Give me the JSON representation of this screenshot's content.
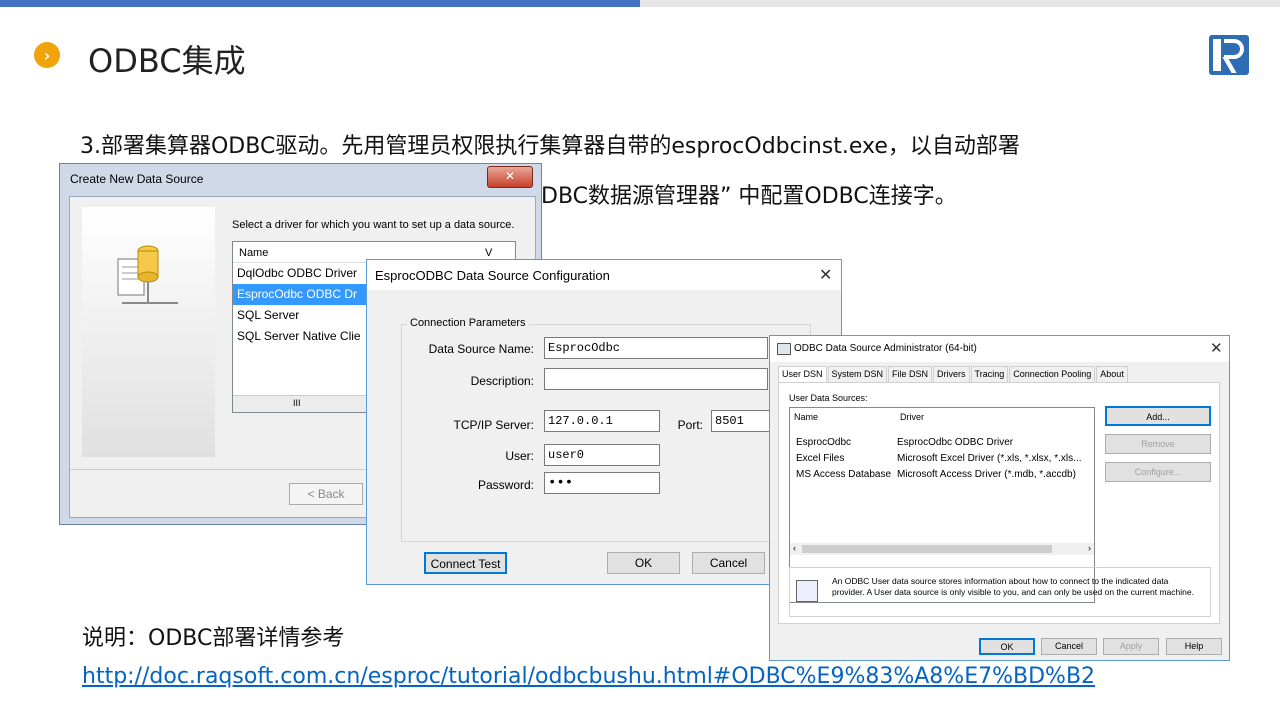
{
  "header": {
    "title": "ODBC集成",
    "bullet_glyph": "›"
  },
  "body": {
    "line1": "3.部署集算器ODBC驱动。先用管理员权限执行集算器自带的esprocOdbcinst.exe，以自动部署",
    "line2_visible": "DBC数据源管理器” 中配置ODBC连接字。"
  },
  "note": "说明：ODBC部署详情参考",
  "link": "http://doc.raqsoft.com.cn/esproc/tutorial/odbcbushu.html#ODBC%E9%83%A8%E7%BD%B2",
  "create_dialog": {
    "title": "Create New Data Source",
    "prompt": "Select a driver for which you want to set up a data source.",
    "column": "Name",
    "column2": "V",
    "drivers": [
      "DqlOdbc ODBC Driver",
      "EsprocOdbc ODBC Dr",
      "SQL Server",
      "SQL Server Native Clie"
    ],
    "back_label": "< Back",
    "scroll_glyph": "III"
  },
  "config_dialog": {
    "title": "EsprocODBC Data Source Configuration",
    "group": "Connection Parameters",
    "fields": {
      "dsn_label": "Data Source Name:",
      "dsn_value": "EsprocOdbc",
      "desc_label": "Description:",
      "desc_value": "",
      "server_label": "TCP/IP Server:",
      "server_value": "127.0.0.1",
      "port_label": "Port:",
      "port_value": "8501",
      "user_label": "User:",
      "user_value": "user0",
      "password_label": "Password:",
      "password_value": "•••"
    },
    "connect_test": "Connect Test",
    "ok": "OK",
    "cancel": "Cancel"
  },
  "admin_dialog": {
    "title": "ODBC Data Source Administrator (64-bit)",
    "tabs": [
      "User DSN",
      "System DSN",
      "File DSN",
      "Drivers",
      "Tracing",
      "Connection Pooling",
      "About"
    ],
    "sub_label": "User Data Sources:",
    "col_name": "Name",
    "col_driver": "Driver",
    "rows": [
      {
        "name": "EsprocOdbc",
        "driver": "EsprocOdbc ODBC Driver"
      },
      {
        "name": "Excel Files",
        "driver": "Microsoft Excel Driver (*.xls, *.xlsx, *.xls..."
      },
      {
        "name": "MS Access Database",
        "driver": "Microsoft Access Driver (*.mdb, *.accdb)"
      }
    ],
    "add": "Add...",
    "remove": "Remove",
    "configure": "Configure...",
    "info": "An ODBC User data source stores information about how to connect to the indicated data provider.  A User data source is only visible to you, and can only be used on the current machine.",
    "ok": "OK",
    "cancel": "Cancel",
    "apply": "Apply",
    "help": "Help"
  }
}
